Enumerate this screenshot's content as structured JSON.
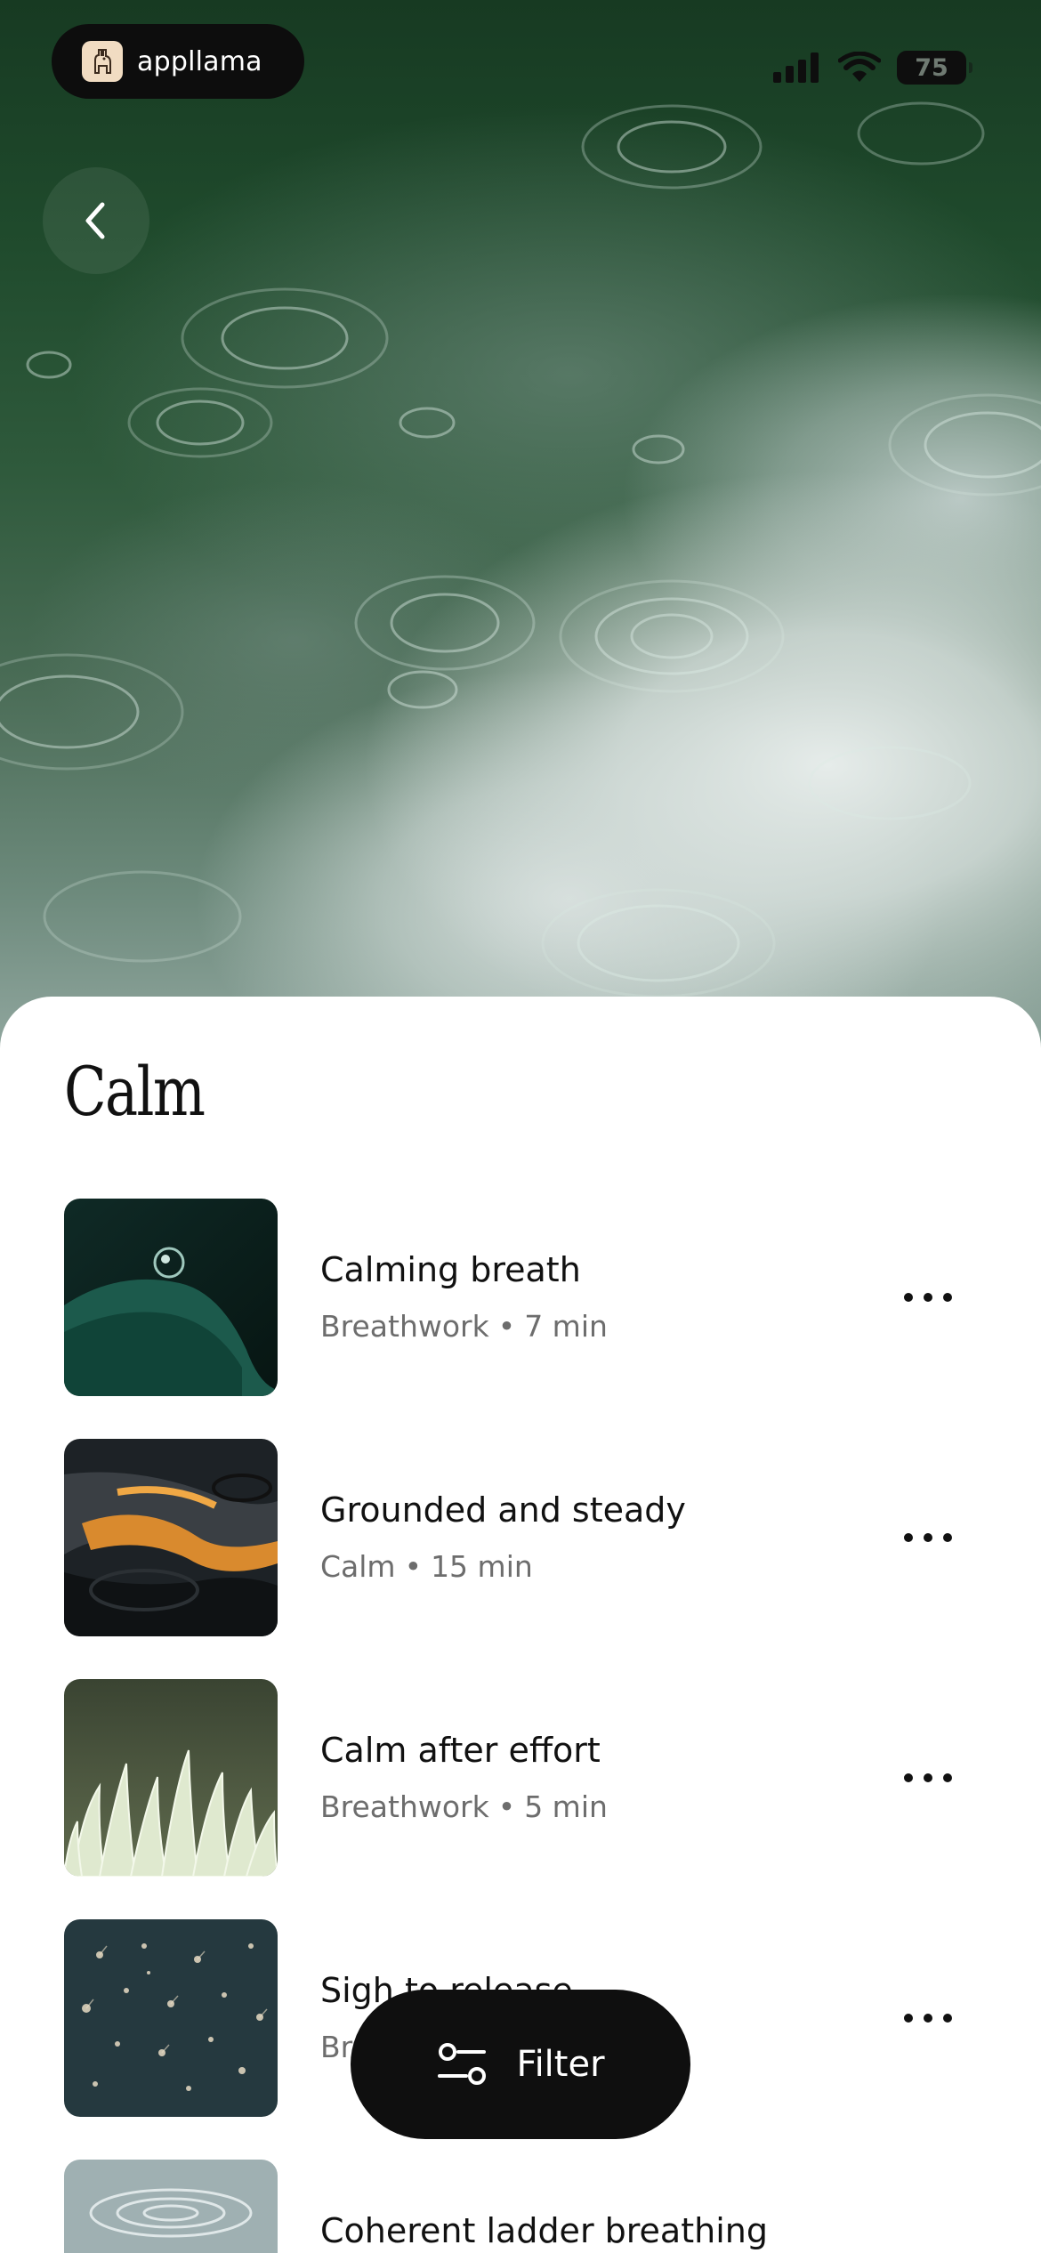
{
  "status_bar": {
    "brand_name": "appllama",
    "battery_level": "75",
    "icons": [
      "llama-logo-icon",
      "cellular-signal-icon",
      "wifi-icon",
      "battery-icon"
    ]
  },
  "navigation": {
    "back_icon": "chevron-left-icon"
  },
  "page": {
    "title": "Calm"
  },
  "items": [
    {
      "title": "Calming breath",
      "category": "Breathwork",
      "duration": "7 min",
      "separator": "•",
      "more_icon": "ellipsis-icon"
    },
    {
      "title": "Grounded and steady",
      "category": "Calm",
      "duration": "15 min",
      "separator": "•",
      "more_icon": "ellipsis-icon"
    },
    {
      "title": "Calm after effort",
      "category": "Breathwork",
      "duration": "5 min",
      "separator": "•",
      "more_icon": "ellipsis-icon"
    },
    {
      "title": "Sigh to release",
      "category": "Br",
      "duration": "",
      "separator": "",
      "more_icon": "ellipsis-icon"
    },
    {
      "title": "Coherent ladder breathing",
      "category": "",
      "duration": "",
      "separator": "",
      "more_icon": "ellipsis-icon"
    }
  ],
  "filter": {
    "label": "Filter",
    "icon": "sliders-icon"
  },
  "colors": {
    "sheet_background": "#ffffff",
    "primary_text": "#111111",
    "secondary_text": "#6d6d6d",
    "pill_background": "#0f0f0f",
    "hero_green": "#1f4a2c"
  }
}
